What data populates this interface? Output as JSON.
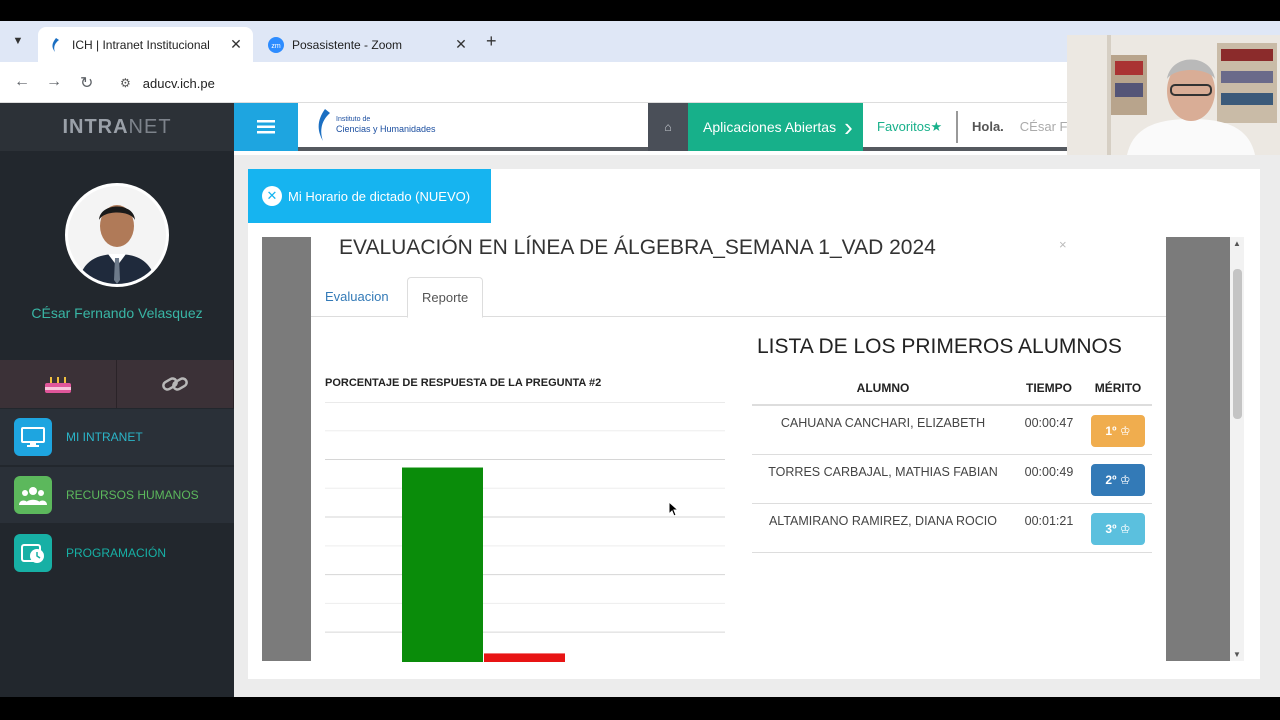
{
  "browser": {
    "tabs": [
      {
        "title": "ICH | Intranet Institucional",
        "active": true
      },
      {
        "title": "Posasistente - Zoom",
        "favicon_text": "zm",
        "active": false
      }
    ],
    "url": "aducv.ich.pe"
  },
  "sidebar": {
    "brand_strong": "INTRA",
    "brand_light": "NET",
    "user_name": "CÉsar Fernando Velasquez",
    "menu": [
      {
        "label": "MI INTRANET",
        "color": "#1ea5e0"
      },
      {
        "label": "RECURSOS HUMANOS",
        "color": "#5cb85c"
      },
      {
        "label": "PROGRAMACIÓN",
        "color": "#17b0a5"
      }
    ]
  },
  "topbar": {
    "logo_line1": "Instituto de",
    "logo_line2": "Ciencias y Humanidades",
    "apps_label": "Aplicaciones Abiertas",
    "favorites_label": "Favoritos",
    "hola": "Hola",
    "hola_name": "CÉsar F"
  },
  "horario_button": "Mi Horario de dictado (NUEVO)",
  "modal": {
    "title": "EVALUACIÓN EN LÍNEA DE ÁLGEBRA_SEMANA 1_VAD 2024",
    "close": "×",
    "tabs": [
      "Evaluacion",
      "Reporte"
    ],
    "active_tab": "Reporte",
    "list_title": "LISTA DE LOS PRIMEROS ALUMNOS",
    "table_headers": [
      "ALUMNO",
      "TIEMPO",
      "MÉRITO"
    ],
    "rows": [
      {
        "alumno": "CAHUANA CANCHARI, ELIZABETH",
        "tiempo": "00:00:47",
        "merito": "1º",
        "color": "#f0ad4e"
      },
      {
        "alumno": "TORRES CARBAJAL, MATHIAS FABIAN",
        "tiempo": "00:00:49",
        "merito": "2º",
        "color": "#337ab7"
      },
      {
        "alumno": "ALTAMIRANO RAMIREZ, DIANA ROCIO",
        "tiempo": "00:01:21",
        "merito": "3º",
        "color": "#5bc0de"
      }
    ]
  },
  "chart_data": {
    "type": "bar",
    "title": "PORCENTAJE DE RESPUESTA DE LA PREGUNTA #2",
    "series": [
      {
        "values": [
          68,
          3
        ],
        "colors": [
          "#0a8c0a",
          "#e81414"
        ]
      }
    ],
    "ylim": [
      0,
      100
    ],
    "grid": true
  }
}
